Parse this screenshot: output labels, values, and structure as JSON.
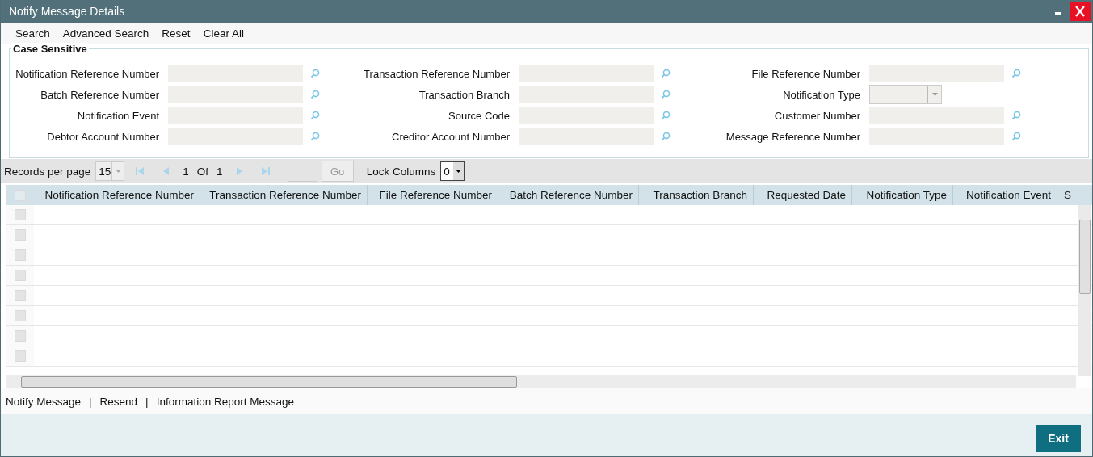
{
  "window": {
    "title": "Notify Message Details"
  },
  "toolbar": [
    "Search",
    "Advanced Search",
    "Reset",
    "Clear All"
  ],
  "criteria": {
    "legend": "Case Sensitive",
    "columns": [
      [
        {
          "label": "Notification Reference Number",
          "kind": "lookup"
        },
        {
          "label": "Batch Reference Number",
          "kind": "lookup"
        },
        {
          "label": "Notification Event",
          "kind": "lookup"
        },
        {
          "label": "Debtor Account Number",
          "kind": "lookup"
        }
      ],
      [
        {
          "label": "Transaction Reference Number",
          "kind": "lookup"
        },
        {
          "label": "Transaction Branch",
          "kind": "lookup"
        },
        {
          "label": "Source Code",
          "kind": "lookup"
        },
        {
          "label": "Creditor Account Number",
          "kind": "lookup"
        }
      ],
      [
        {
          "label": "File Reference Number",
          "kind": "lookup"
        },
        {
          "label": "Notification Type",
          "kind": "select"
        },
        {
          "label": "Customer Number",
          "kind": "lookup"
        },
        {
          "label": "Message Reference Number",
          "kind": "lookup"
        }
      ]
    ]
  },
  "pager": {
    "records_label": "Records per page",
    "records_value": "15",
    "page": "1",
    "of": "Of",
    "total": "1",
    "go": {
      "label": "Go",
      "disabled": true
    },
    "lock_label": "Lock Columns",
    "lock_value": "0"
  },
  "table": {
    "all_checked": false,
    "rows": [
      {
        "checked": false
      },
      {
        "checked": false
      },
      {
        "checked": false
      },
      {
        "checked": false
      },
      {
        "checked": false
      },
      {
        "checked": false
      },
      {
        "checked": false
      },
      {
        "checked": false
      }
    ],
    "columns": [
      "Notification Reference Number",
      "Transaction Reference Number",
      "File Reference Number",
      "Batch Reference Number",
      "Transaction Branch",
      "Requested Date",
      "Notification Type",
      "Notification Event",
      "S"
    ]
  },
  "links": [
    "Notify Message",
    "Resend",
    "Information Report Message"
  ],
  "link_separator": "|",
  "exit": "Exit"
}
